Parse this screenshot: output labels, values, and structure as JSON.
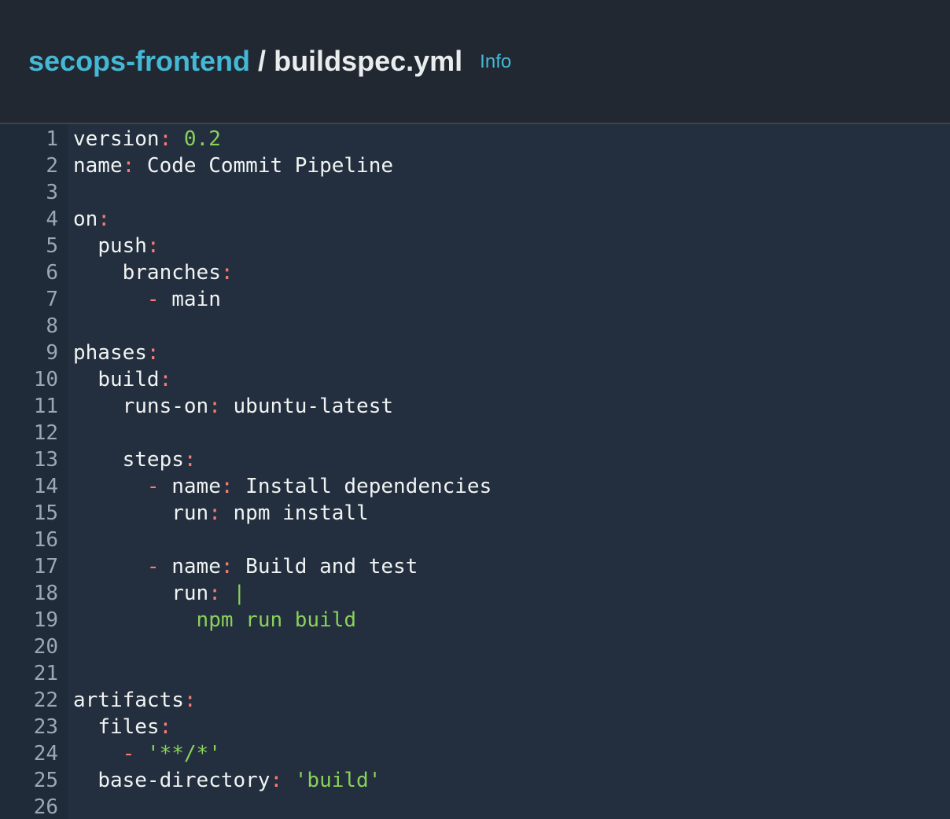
{
  "header": {
    "repo": "secops-frontend",
    "separator": "/",
    "file": "buildspec.yml",
    "info": "Info"
  },
  "code": {
    "lines": [
      [
        {
          "t": "version",
          "c": "k"
        },
        {
          "t": ":",
          "c": "p"
        },
        {
          "t": " "
        },
        {
          "t": "0.2",
          "c": "n"
        }
      ],
      [
        {
          "t": "name",
          "c": "k"
        },
        {
          "t": ":",
          "c": "p"
        },
        {
          "t": " Code Commit Pipeline",
          "c": "v"
        }
      ],
      [],
      [
        {
          "t": "on",
          "c": "k"
        },
        {
          "t": ":",
          "c": "p"
        }
      ],
      [
        {
          "t": "  "
        },
        {
          "t": "push",
          "c": "k"
        },
        {
          "t": ":",
          "c": "p"
        }
      ],
      [
        {
          "t": "    "
        },
        {
          "t": "branches",
          "c": "k"
        },
        {
          "t": ":",
          "c": "p"
        }
      ],
      [
        {
          "t": "      "
        },
        {
          "t": "-",
          "c": "p"
        },
        {
          "t": " main",
          "c": "v"
        }
      ],
      [],
      [
        {
          "t": "phases",
          "c": "k"
        },
        {
          "t": ":",
          "c": "p"
        }
      ],
      [
        {
          "t": "  "
        },
        {
          "t": "build",
          "c": "k"
        },
        {
          "t": ":",
          "c": "p"
        }
      ],
      [
        {
          "t": "    "
        },
        {
          "t": "runs-on",
          "c": "k"
        },
        {
          "t": ":",
          "c": "p"
        },
        {
          "t": " ubuntu-latest",
          "c": "v"
        }
      ],
      [],
      [
        {
          "t": "    "
        },
        {
          "t": "steps",
          "c": "k"
        },
        {
          "t": ":",
          "c": "p"
        }
      ],
      [
        {
          "t": "      "
        },
        {
          "t": "-",
          "c": "p"
        },
        {
          "t": " "
        },
        {
          "t": "name",
          "c": "k"
        },
        {
          "t": ":",
          "c": "p"
        },
        {
          "t": " Install dependencies",
          "c": "v"
        }
      ],
      [
        {
          "t": "        "
        },
        {
          "t": "run",
          "c": "k"
        },
        {
          "t": ":",
          "c": "p"
        },
        {
          "t": " npm install",
          "c": "v"
        }
      ],
      [],
      [
        {
          "t": "      "
        },
        {
          "t": "-",
          "c": "p"
        },
        {
          "t": " "
        },
        {
          "t": "name",
          "c": "k"
        },
        {
          "t": ":",
          "c": "p"
        },
        {
          "t": " Build and test",
          "c": "v"
        }
      ],
      [
        {
          "t": "        "
        },
        {
          "t": "run",
          "c": "k"
        },
        {
          "t": ":",
          "c": "p"
        },
        {
          "t": " "
        },
        {
          "t": "|",
          "c": "s"
        }
      ],
      [
        {
          "t": "          "
        },
        {
          "t": "npm run build",
          "c": "s"
        }
      ],
      [],
      [],
      [
        {
          "t": "artifacts",
          "c": "k"
        },
        {
          "t": ":",
          "c": "p"
        }
      ],
      [
        {
          "t": "  "
        },
        {
          "t": "files",
          "c": "k"
        },
        {
          "t": ":",
          "c": "p"
        }
      ],
      [
        {
          "t": "    "
        },
        {
          "t": "-",
          "c": "p"
        },
        {
          "t": " "
        },
        {
          "t": "'**/*'",
          "c": "s"
        }
      ],
      [
        {
          "t": "  "
        },
        {
          "t": "base-directory",
          "c": "k"
        },
        {
          "t": ":",
          "c": "p"
        },
        {
          "t": " "
        },
        {
          "t": "'build'",
          "c": "s"
        }
      ],
      []
    ]
  }
}
